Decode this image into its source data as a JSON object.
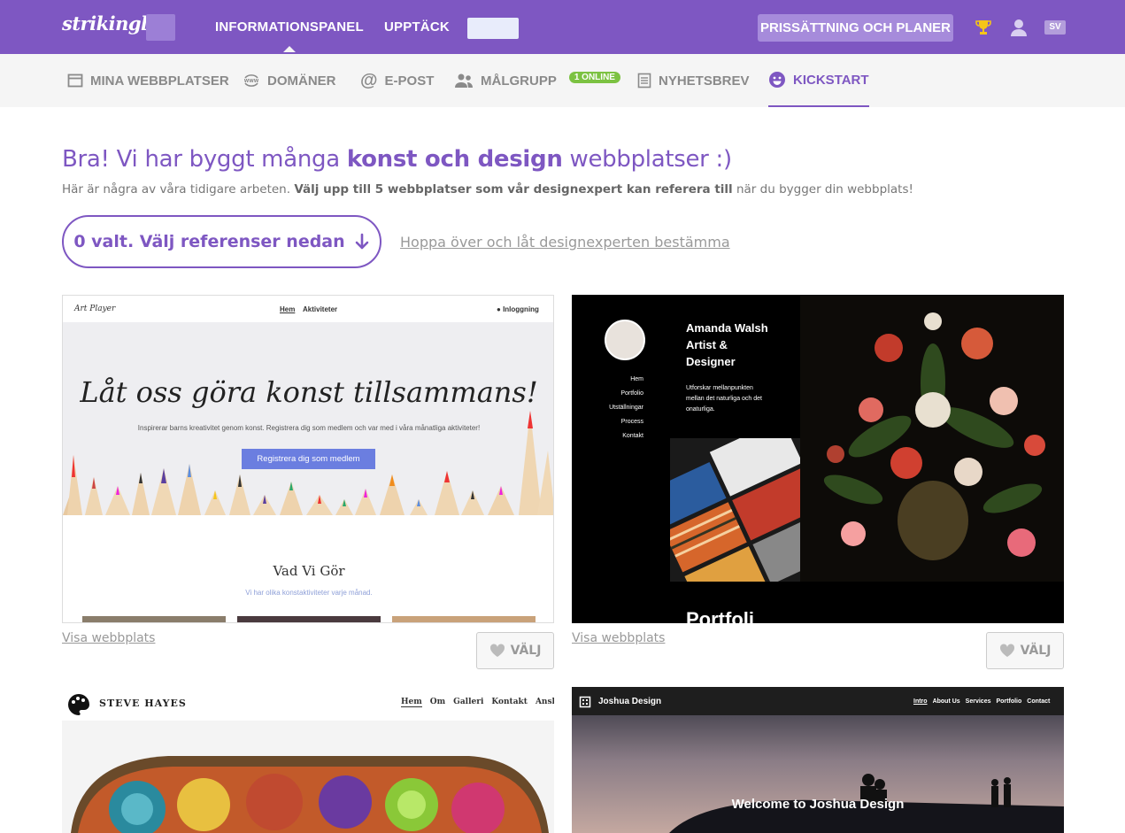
{
  "header": {
    "logo": "strikingly",
    "nav": [
      "INFORMATIONSPANEL",
      "UPPTÄCK"
    ],
    "pricing": "PRISSÄTTNING OCH PLANER",
    "lang": "SV"
  },
  "subnav": {
    "items": [
      {
        "label": "MINA WEBBPLATSER",
        "icon": "browser-icon"
      },
      {
        "label": "DOMÄNER",
        "icon": "www-icon"
      },
      {
        "label": "E-POST",
        "icon": "at-icon"
      },
      {
        "label": "MÅLGRUPP",
        "icon": "users-icon",
        "badge": "1 ONLINE"
      },
      {
        "label": "NYHETSBREV",
        "icon": "newsletter-icon"
      },
      {
        "label": "KICKSTART",
        "icon": "smile-icon",
        "active": true
      }
    ]
  },
  "main": {
    "headline_pre": "Bra! Vi har byggt många ",
    "headline_bold": "konst och design",
    "headline_post": " webbplatser :)",
    "subline_pre": "Här är några av våra tidigare arbeten. ",
    "subline_bold": "Välj upp till 5 webbplatser som vår designexpert kan referera till",
    "subline_post": " när du bygger din webbplats!",
    "select_button": "0 valt. Välj referenser nedan",
    "skip_link": "Hoppa över och låt designexperten bestämma",
    "view_site": "Visa webbplats",
    "choose": "VÄLJ"
  },
  "templates": {
    "t1": {
      "brand": "Art Player",
      "nav": [
        "Hem",
        "Aktiviteter"
      ],
      "login": "Inloggning",
      "title": "Låt oss göra konst tillsammans!",
      "subtitle": "Inspirerar barns kreativitet genom konst. Registrera dig som medlem och var med i våra månatliga aktiviteter!",
      "button": "Registrera dig som medlem",
      "section_title": "Vad Vi Gör",
      "section_sub": "Vi har olika konstaktiviteter varje månad."
    },
    "t2": {
      "name": "Amanda Walsh Artist & Designer",
      "name_lines": [
        "Amanda Walsh",
        "Artist &",
        "Designer"
      ],
      "nav": [
        "Hem",
        "Portfolio",
        "Utställningar",
        "Process",
        "Kontakt"
      ],
      "text_lines": [
        "Utforskar mellanpunkten",
        "mellan det naturliga och det",
        "onaturliga."
      ],
      "partial": "Portfoli"
    },
    "t3": {
      "brand": "STEVE HAYES",
      "nav": [
        "Hem",
        "Om",
        "Galleri",
        "Kontakt",
        "Anslut"
      ]
    },
    "t4": {
      "brand": "Joshua Design",
      "nav": [
        "Intro",
        "About Us",
        "Services",
        "Portfolio",
        "Contact"
      ],
      "hero": "Welcome to Joshua Design"
    }
  },
  "colors": {
    "brand": "#7e57c2",
    "badge": "#7cc242"
  }
}
